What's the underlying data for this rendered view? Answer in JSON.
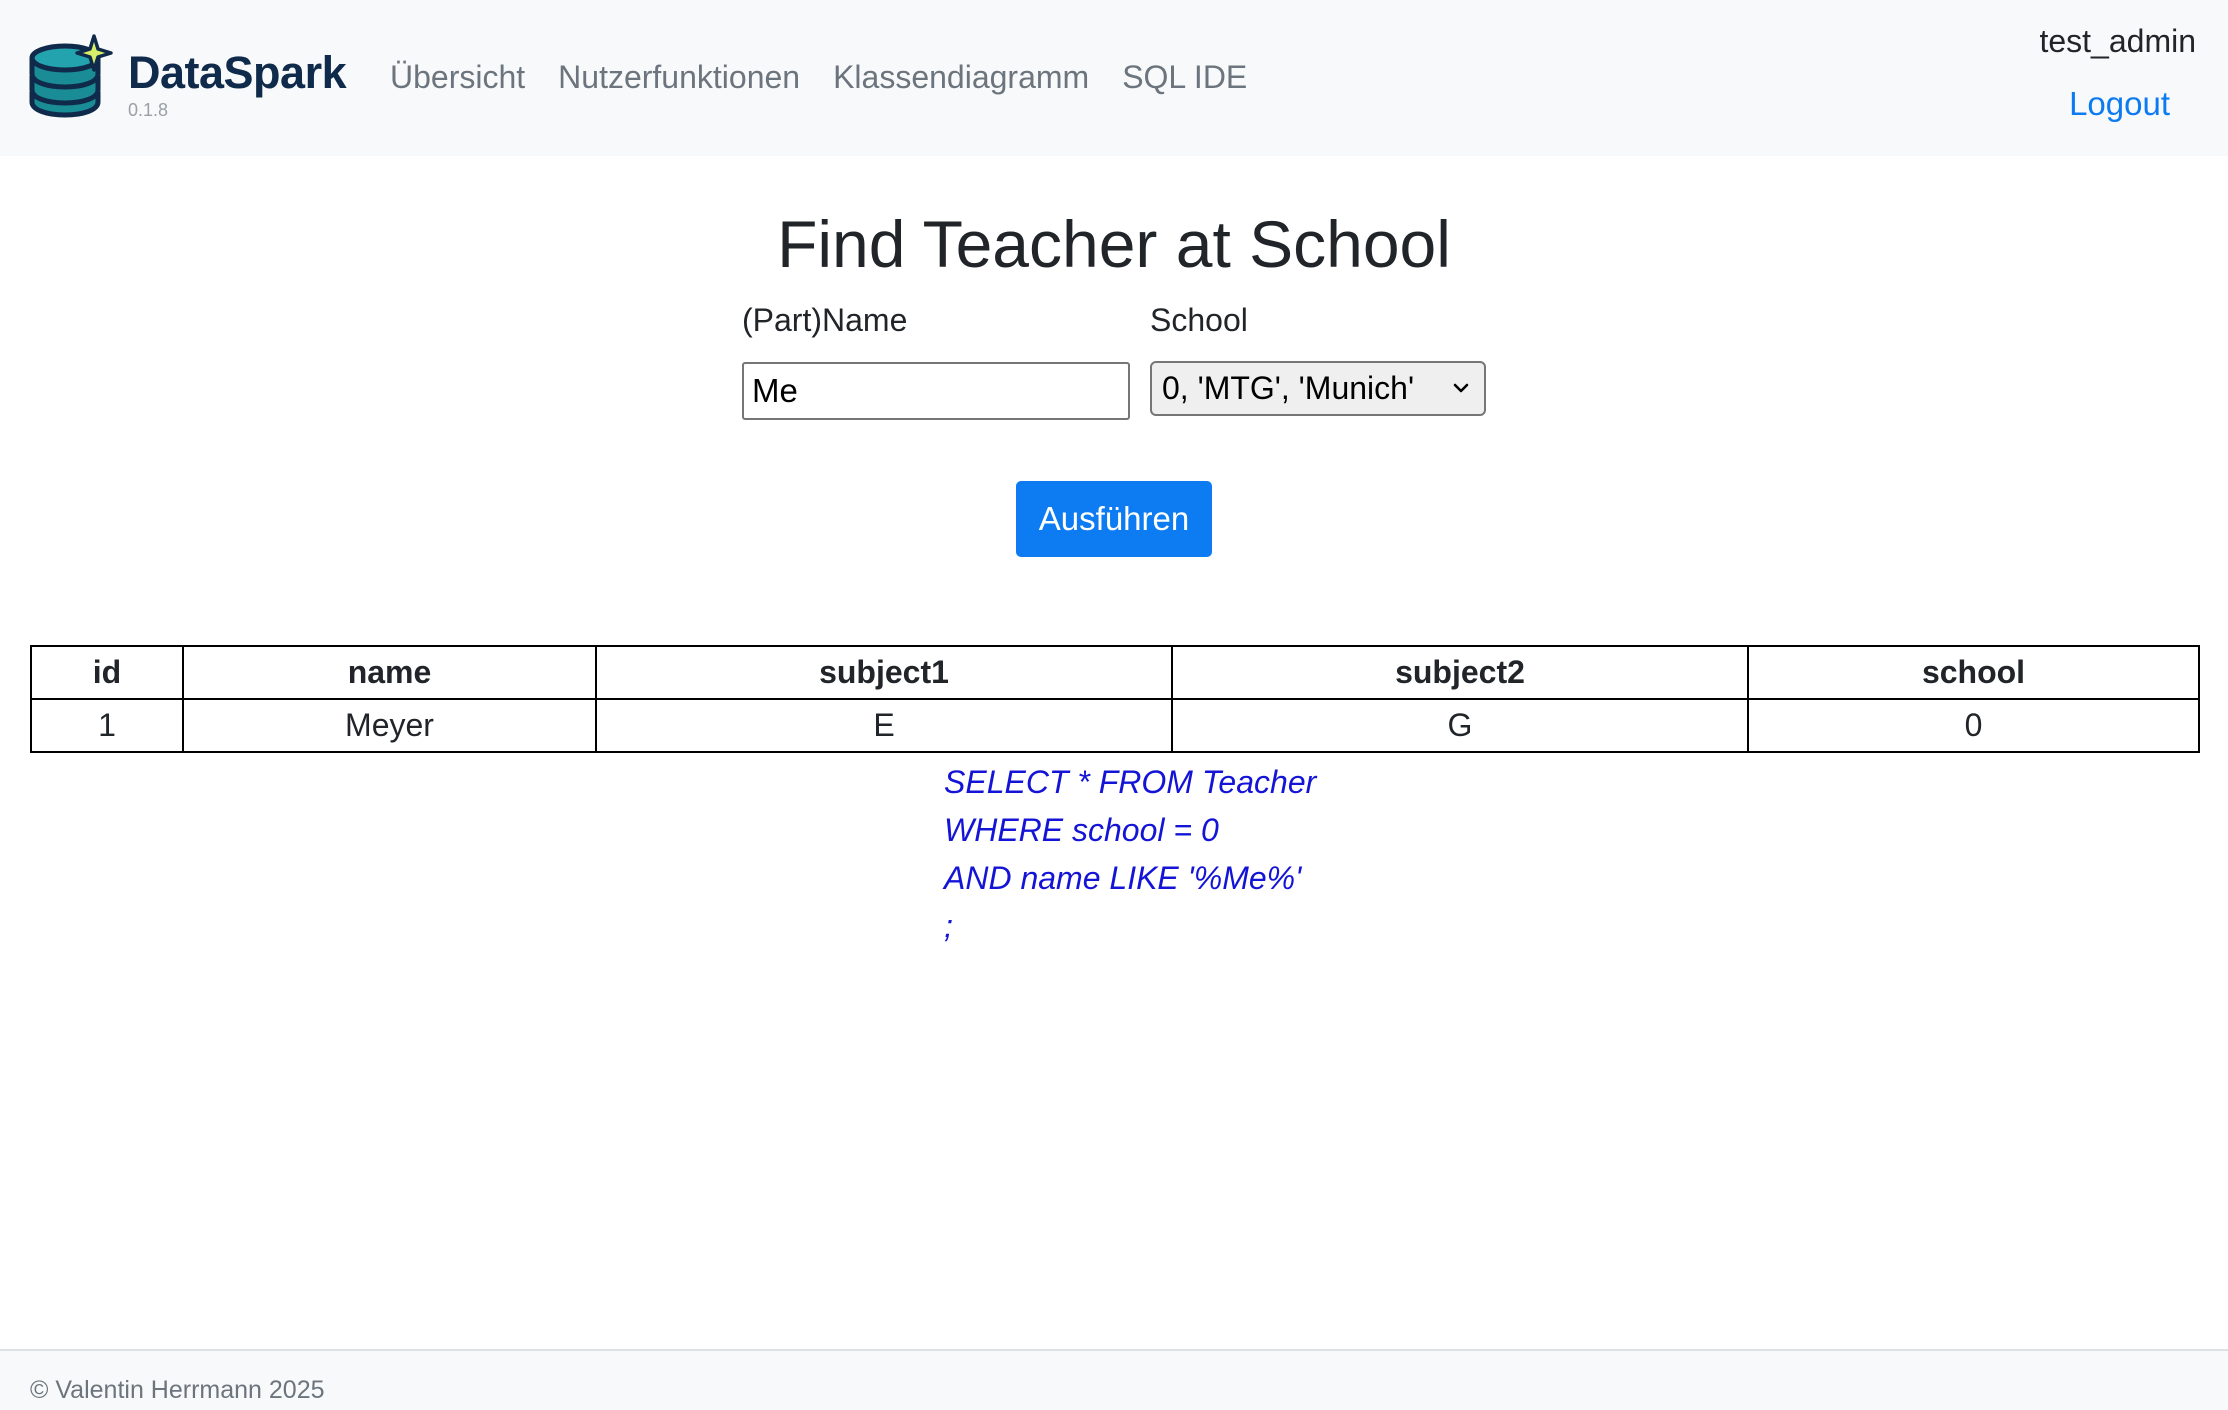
{
  "navbar": {
    "brand": "DataSpark",
    "version": "0.1.8",
    "links": [
      "Übersicht",
      "Nutzerfunktionen",
      "Klassendiagramm",
      "SQL IDE"
    ],
    "user": "test_admin",
    "logout": "Logout"
  },
  "page": {
    "title": "Find Teacher at School"
  },
  "form": {
    "name_label": "(Part)Name",
    "name_value": "Me",
    "school_label": "School",
    "school_selected": "0, 'MTG', 'Munich'",
    "run_label": "Ausführen"
  },
  "table": {
    "headers": [
      "id",
      "name",
      "subject1",
      "subject2",
      "school"
    ],
    "rows": [
      [
        "1",
        "Meyer",
        "E",
        "G",
        "0"
      ]
    ]
  },
  "sql": {
    "lines": [
      "SELECT * FROM Teacher",
      "WHERE school = 0",
      "AND name LIKE '%Me%'",
      ";"
    ]
  },
  "footer": {
    "text": "© Valentin Herrmann 2025"
  },
  "colors": {
    "link_blue": "#0d7bf0",
    "button_blue": "#0d7cf2",
    "sql_blue": "#1414d6",
    "brand_dark": "#0f2a4a",
    "logo_teal": "#1a8c96"
  },
  "icons": {
    "logo": "database-sparkle-icon",
    "select": "chevron-down-icon"
  }
}
